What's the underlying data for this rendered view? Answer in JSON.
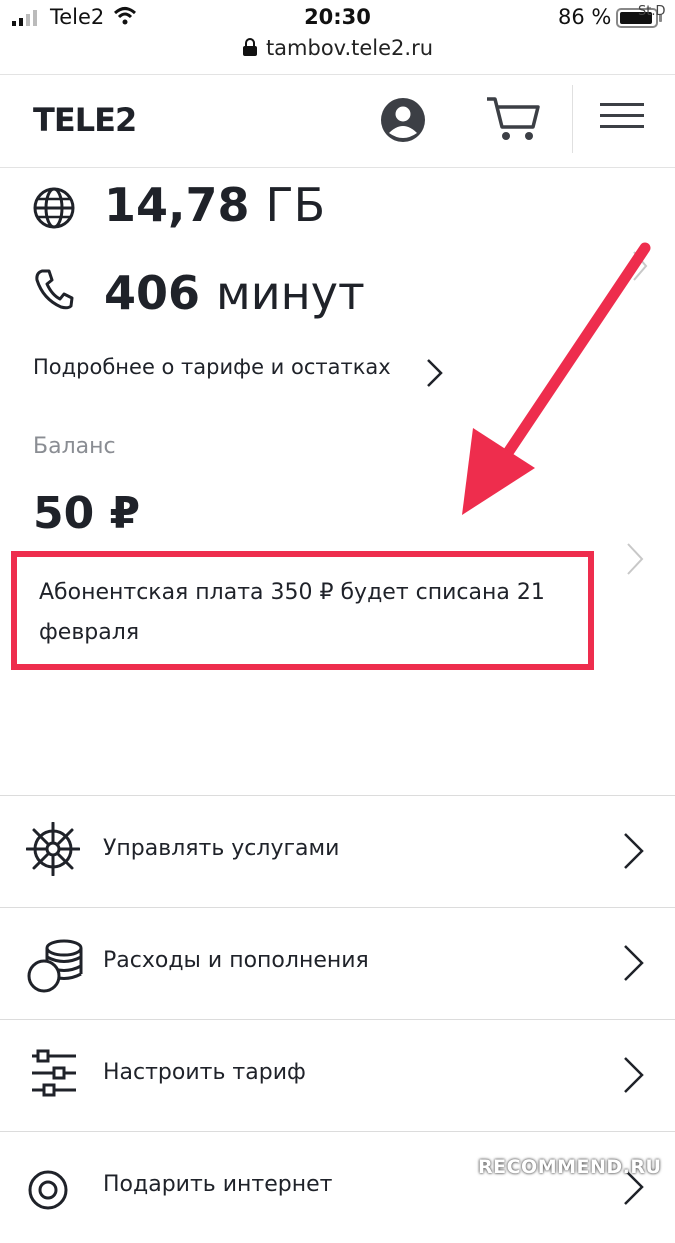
{
  "status_bar": {
    "carrier": "Tele2",
    "time": "20:30",
    "battery": "86 %",
    "watermark": "St.D"
  },
  "browser": {
    "url": "tambov.tele2.ru"
  },
  "header": {
    "logo": "TELE2",
    "icons": [
      "profile-icon",
      "cart-icon",
      "menu-icon"
    ]
  },
  "remains": {
    "data_value": "14,78",
    "data_unit": "ГБ",
    "minutes_value": "406",
    "minutes_unit": "минут",
    "details_link": "Подробнее о тарифе и остатках"
  },
  "balance": {
    "label": "Баланс",
    "value": "50 ₽",
    "fee_notice": "Абонентская плата 350 ₽ будет списана 21 февраля"
  },
  "menu": {
    "items": [
      {
        "label": "Управлять услугами",
        "icon": "helm-icon"
      },
      {
        "label": "Расходы и пополнения",
        "icon": "coins-icon"
      },
      {
        "label": "Настроить тариф",
        "icon": "sliders-icon"
      },
      {
        "label": "Подарить интернет",
        "icon": "gift-icon"
      }
    ]
  },
  "watermark_bottom": "RECOMMEND.RU",
  "colors": {
    "highlight": "#ee2d4d",
    "text": "#1f2229",
    "muted": "#8a8d93"
  }
}
